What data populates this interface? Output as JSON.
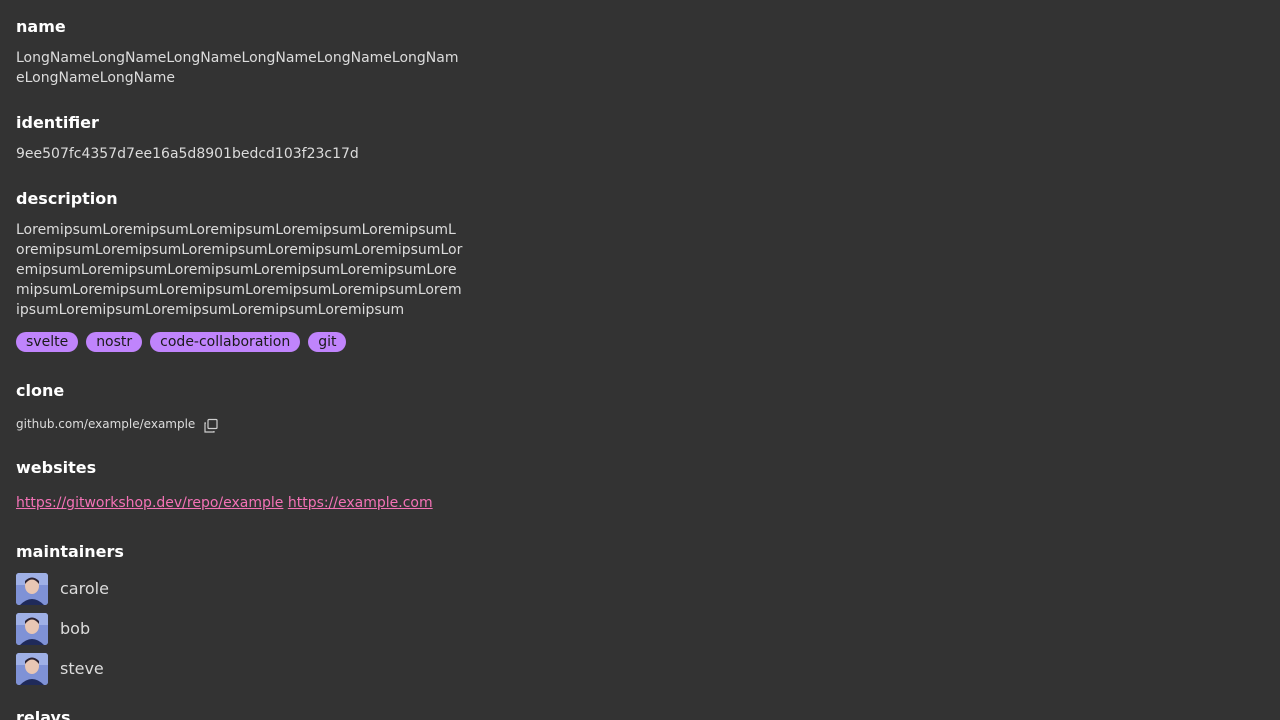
{
  "sections": {
    "name": "name",
    "identifier": "identifier",
    "description": "description",
    "clone": "clone",
    "websites": "websites",
    "maintainers": "maintainers",
    "relays": "relays"
  },
  "repo": {
    "name": "LongNameLongNameLongNameLongNameLongNameLongNameLongNameLongName",
    "identifier": "9ee507fc4357d7ee16a5d8901bedcd103f23c17d",
    "description": "LoremipsumLoremipsumLoremipsumLoremipsumLoremipsumLoremipsumLoremipsumLoremipsumLoremipsumLoremipsumLoremipsumLoremipsumLoremipsumLoremipsumLoremipsumLoremipsumLoremipsumLoremipsumLoremipsumLoremipsumLoremipsumLoremipsumLoremipsumLoremipsumLoremipsum",
    "tags": [
      "svelte",
      "nostr",
      "code-collaboration",
      "git"
    ],
    "clone_url": "github.com/example/example",
    "websites": [
      "https://gitworkshop.dev/repo/example",
      "https://example.com"
    ],
    "maintainers": [
      "carole",
      "bob",
      "steve"
    ]
  },
  "colors": {
    "background": "#333333",
    "tag_bg": "#c084fc",
    "link": "#f472b6"
  },
  "icons": {
    "copy": "copy-icon",
    "avatar": "avatar-image"
  }
}
